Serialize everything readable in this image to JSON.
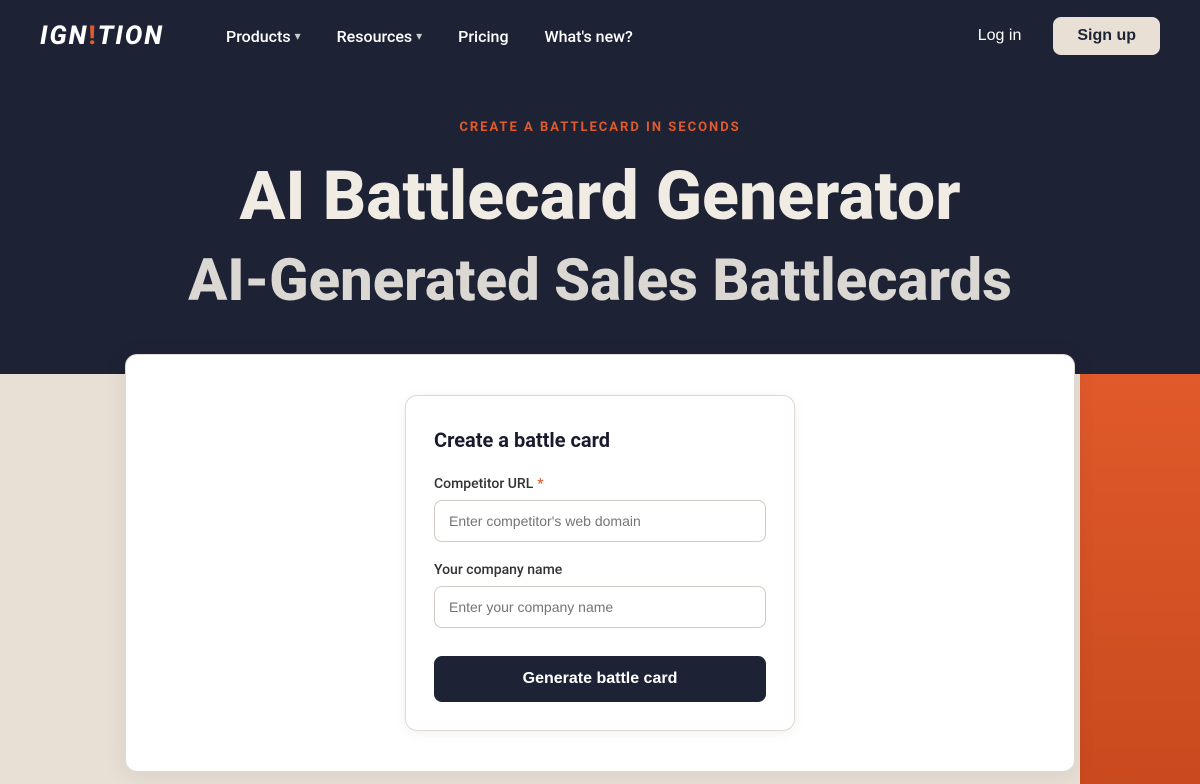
{
  "nav": {
    "logo": "IGN!TION",
    "items": [
      {
        "label": "Products",
        "hasDropdown": true
      },
      {
        "label": "Resources",
        "hasDropdown": true
      },
      {
        "label": "Pricing",
        "hasDropdown": false
      },
      {
        "label": "What's new?",
        "hasDropdown": false
      }
    ],
    "login_label": "Log in",
    "signup_label": "Sign up"
  },
  "hero": {
    "tag": "CREATE A BATTLECARD IN SECONDS",
    "title": "AI Battlecard Generator",
    "subtitle": "AI-Generated Sales Battlecards"
  },
  "form": {
    "title": "Create a battle card",
    "competitor_url_label": "Competitor URL",
    "competitor_url_placeholder": "Enter competitor's web domain",
    "company_name_label": "Your company name",
    "company_name_placeholder": "Enter your company name",
    "generate_label": "Generate battle card"
  }
}
